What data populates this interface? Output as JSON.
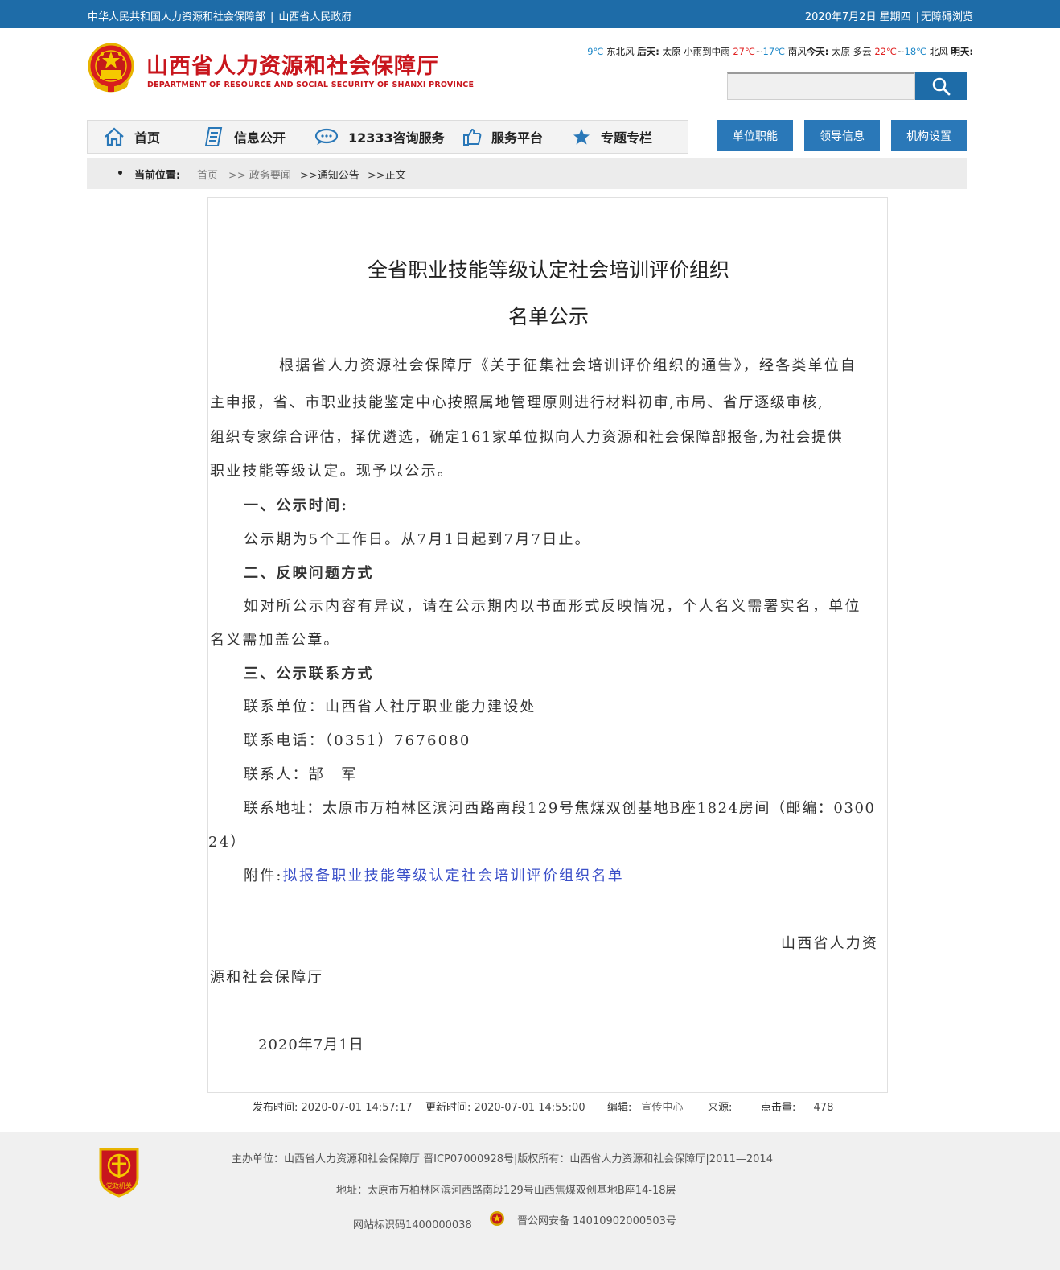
{
  "topbar": {
    "link1": "中华人民共和国人力资源和社会保障部",
    "link2": "山西省人民政府",
    "date": "2020年7月2日 星期四",
    "accessibility": "无障碍浏览"
  },
  "header": {
    "title": "山西省人力资源和社会保障厅",
    "subtitle": "DEPARTMENT OF RESOURCE AND SOCIAL SECURITY OF SHANXI PROVINCE",
    "weather": {
      "t1": "9℃",
      "w1": "东北风",
      "d2": "后天:",
      "c2": "太原 小雨到中雨",
      "h2": "27℃",
      "tilde": "~",
      "l2": "17℃",
      "w2": "南风",
      "d3": "今天:",
      "c3": "太原 多云",
      "h3": "22℃",
      "l3": "18℃",
      "w3": "北风",
      "d4": "明天:"
    }
  },
  "nav": {
    "items": [
      {
        "label": "首页",
        "icon": "home-icon"
      },
      {
        "label": "信息公开",
        "icon": "document-icon"
      },
      {
        "label": "12333咨询服务",
        "icon": "chat-icon"
      },
      {
        "label": "服务平台",
        "icon": "thumbs-up-icon"
      },
      {
        "label": "专题专栏",
        "icon": "star-icon"
      }
    ],
    "buttons": [
      "单位职能",
      "领导信息",
      "机构设置"
    ]
  },
  "breadcrumb": {
    "label": "当前位置:",
    "home": "首页",
    "c1": ">> 政务要闻",
    "c2": ">>通知公告",
    "c3": ">>正文"
  },
  "article": {
    "title1": "全省职业技能等级认定社会培训评价组织",
    "title2": "名单公示",
    "para1": [
      "根据省人力资源社会保障厅《关于征集社会培训评价组织的通告》，经各类单位自",
      "主申报，省、市职业技能鉴定中心按照属地管理原则进行材料初审,市局、省厅逐级审核,",
      "组织专家综合评估，择优遴选，确定161家单位拟向人力资源和社会保障部报备,为社会提供",
      "职业技能等级认定。现予以公示。"
    ],
    "h1": "一、公示时间:",
    "time": "公示期为5个工作日。从7月1日起到7月7日止。",
    "h2": "二、反映问题方式",
    "feedback": [
      "如对所公示内容有异议，请在公示期内以书面形式反映情况，个人名义需署实名，单位",
      "名义需加盖公章。"
    ],
    "h3": "三、公示联系方式",
    "unit": "联系单位：山西省人社厅职业能力建设处",
    "phone": "联系电话：（0351）7676080",
    "person": "联系人：郜　军",
    "address": [
      "联系地址：太原市万柏林区滨河西路南段129号焦煤双创基地B座1824房间（邮编：0300",
      "24）"
    ],
    "attach_label": "附件:",
    "attach_link": "拟报备职业技能等级认定社会培训评价组织名单",
    "sign1": "山西省人力资",
    "sign2": "源和社会保障厅",
    "date": "2020年7月1日"
  },
  "meta": {
    "publish_label": "发布时间:",
    "publish": "2020-07-01 14:57:17",
    "update_label": "更新时间:",
    "update": "2020-07-01 14:55:00",
    "editor_label": "编辑:",
    "editor": "宣传中心",
    "source_label": "来源:",
    "views_label": "点击量:",
    "views": "478"
  },
  "footer": {
    "line1": "主办单位：山西省人力资源和社会保障厅 晋ICP07000928号|版权所有：山西省人力资源和社会保障厅|2011—2014",
    "line2": "地址：太原市万柏林区滨河西路南段129号山西焦煤双创基地B座14-18层",
    "site_id": "网站标识码1400000038",
    "police": "晋公网安备 14010902000503号",
    "badge": "党政机关"
  },
  "colors": {
    "brand_blue": "#1e6ca8",
    "title_red": "#c8161d",
    "link_blue": "#3a4fc8"
  }
}
